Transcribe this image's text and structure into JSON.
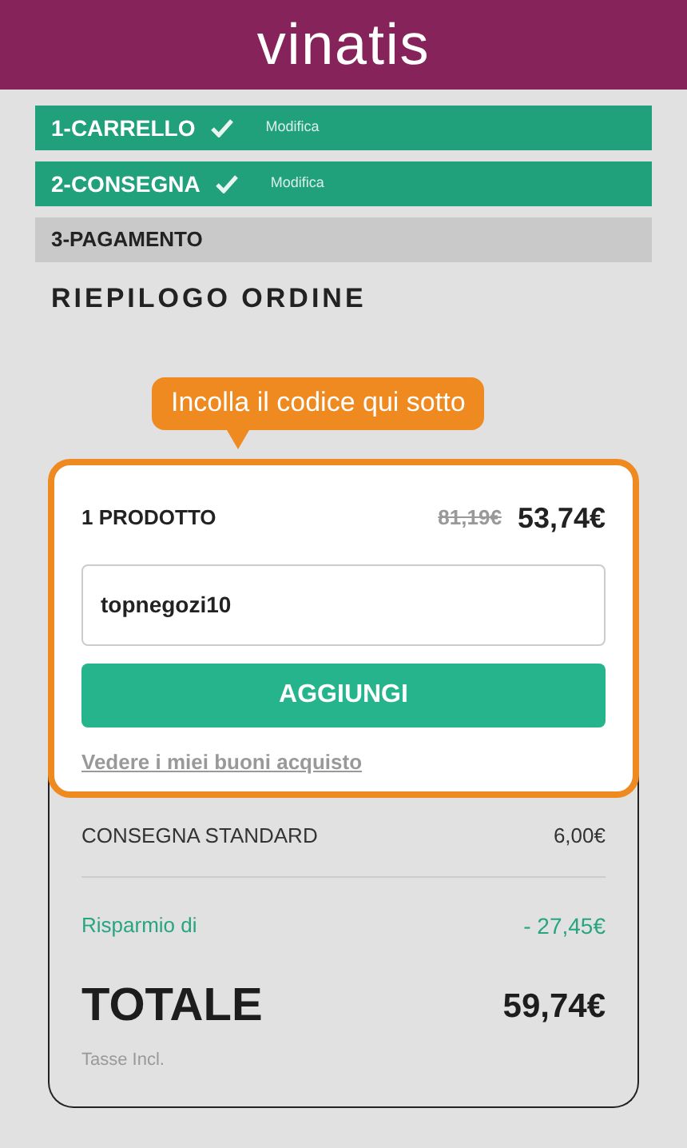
{
  "header": {
    "logo": "vinatis"
  },
  "steps": [
    {
      "label": "1-CARRELLO",
      "kind": "done",
      "action": "Modifica"
    },
    {
      "label": "2-CONSEGNA",
      "kind": "done",
      "action": "Modifica"
    },
    {
      "label": "3-PAGAMENTO",
      "kind": "current"
    }
  ],
  "title": "RIEPILOGO ORDINE",
  "tooltip": "Incolla il codice qui sotto",
  "product": {
    "label": "1 PRODOTTO",
    "old_price": "81,19€",
    "price": "53,74€"
  },
  "coupon": {
    "value": "topnegozi10",
    "button": "AGGIUNGI",
    "link": "Vedere i miei buoni acquisto"
  },
  "summary": {
    "shipping_label": "CONSEGNA STANDARD",
    "shipping_price": "6,00€",
    "savings_label": "Risparmio di",
    "savings_value": "- 27,45€",
    "total_label": "TOTALE",
    "total_value": "59,74€",
    "tax_note": "Tasse Incl."
  }
}
